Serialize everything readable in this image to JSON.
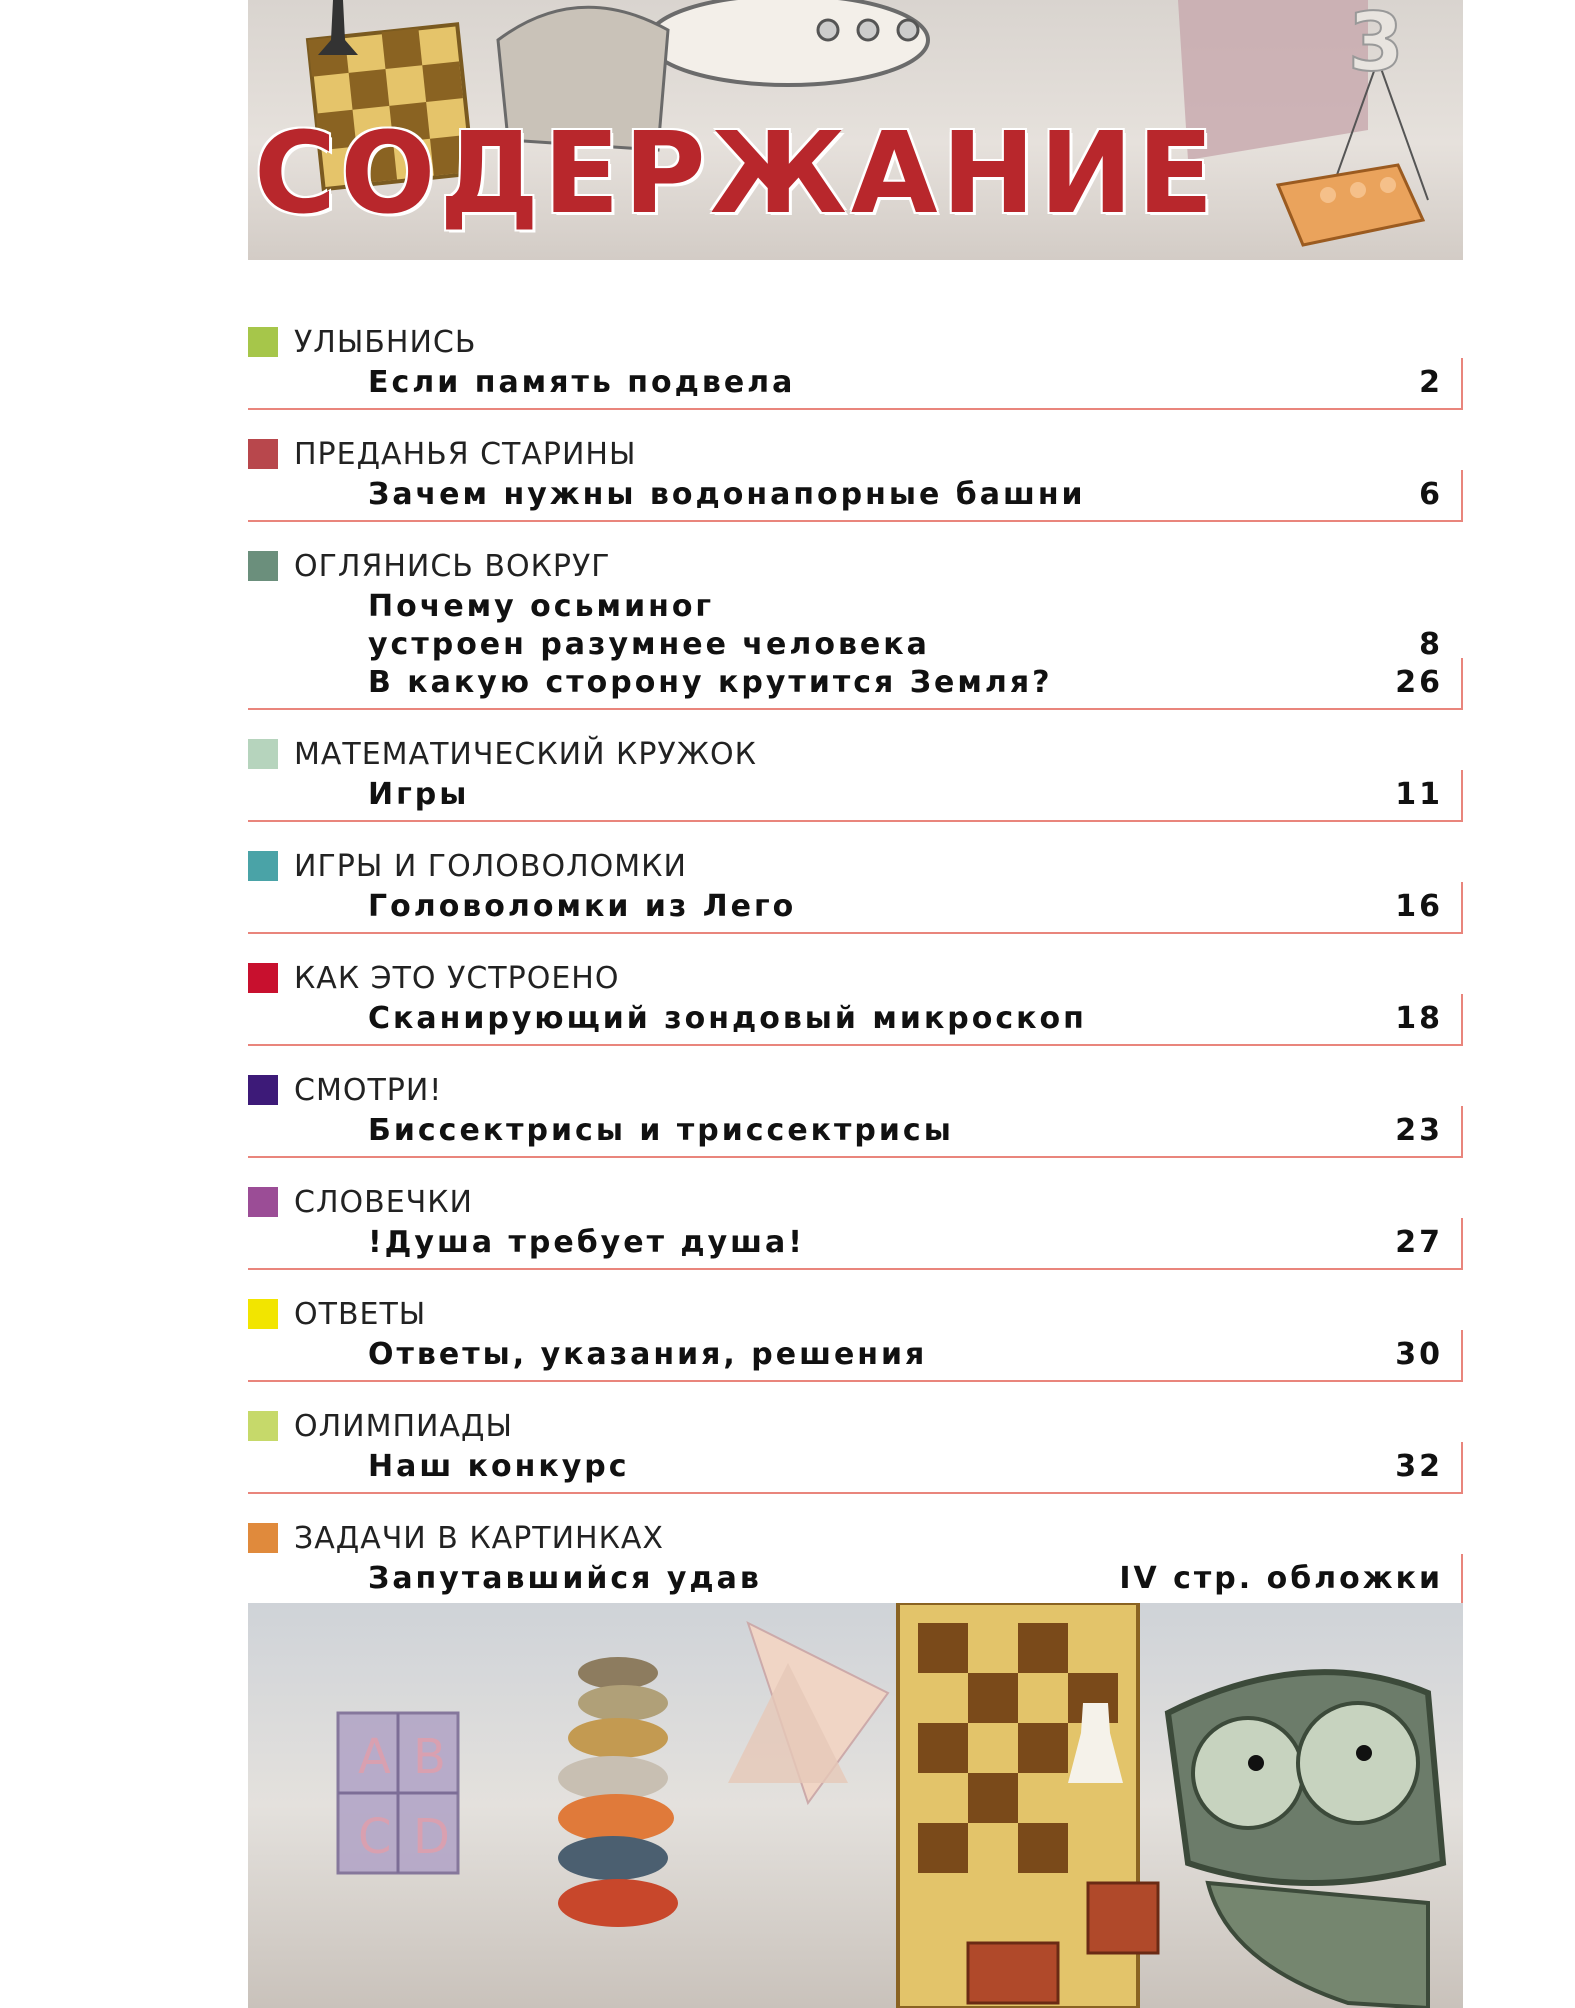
{
  "header": {
    "title": "СОДЕРЖАНИЕ"
  },
  "sections": [
    {
      "name": "УЛЫБНИСЬ",
      "color": "#a6c64a",
      "entries": [
        {
          "title": "Если память подвела",
          "page": "2"
        }
      ]
    },
    {
      "name": "ПРЕДАНЬЯ СТАРИНЫ",
      "color": "#b8474c",
      "entries": [
        {
          "title": "Зачем нужны водонапорные башни",
          "page": "6"
        }
      ]
    },
    {
      "name": "ОГЛЯНИСЬ ВОКРУГ",
      "color": "#6b8f7c",
      "entries": [
        {
          "title": "Почему осьминог\nустроен разумнее человека",
          "page": "8"
        },
        {
          "title": "В какую сторону крутится Земля?",
          "page": "26"
        }
      ]
    },
    {
      "name": "МАТЕМАТИЧЕСКИЙ КРУЖОК",
      "color": "#b6d4bd",
      "entries": [
        {
          "title": "Игры",
          "page": "11"
        }
      ]
    },
    {
      "name": "ИГРЫ И ГОЛОВОЛОМКИ",
      "color": "#4aa3a7",
      "entries": [
        {
          "title": "Головоломки из Лего",
          "page": "16"
        }
      ]
    },
    {
      "name": "КАК ЭТО УСТРОЕНО",
      "color": "#c8102e",
      "entries": [
        {
          "title": "Сканирующий зондовый микроскоп",
          "page": "18"
        }
      ]
    },
    {
      "name": "СМОТРИ!",
      "color": "#3d1a78",
      "entries": [
        {
          "title": "Биссектрисы и триссектрисы",
          "page": "23"
        }
      ]
    },
    {
      "name": "СЛОВЕЧКИ",
      "color": "#9b4d96",
      "entries": [
        {
          "title": "!Душа требует душа!",
          "page": "27"
        }
      ]
    },
    {
      "name": "ОТВЕТЫ",
      "color": "#f2e500",
      "entries": [
        {
          "title": "Ответы, указания, решения",
          "page": "30"
        }
      ]
    },
    {
      "name": "ОЛИМПИАДЫ",
      "color": "#c6d96a",
      "entries": [
        {
          "title": "Наш конкурс",
          "page": "32"
        }
      ]
    },
    {
      "name": "ЗАДАЧИ В КАРТИНКАХ",
      "color": "#e08a3c",
      "entries": [
        {
          "title": "Запутавшийся удав",
          "page": "IV стр. обложки"
        }
      ]
    }
  ]
}
